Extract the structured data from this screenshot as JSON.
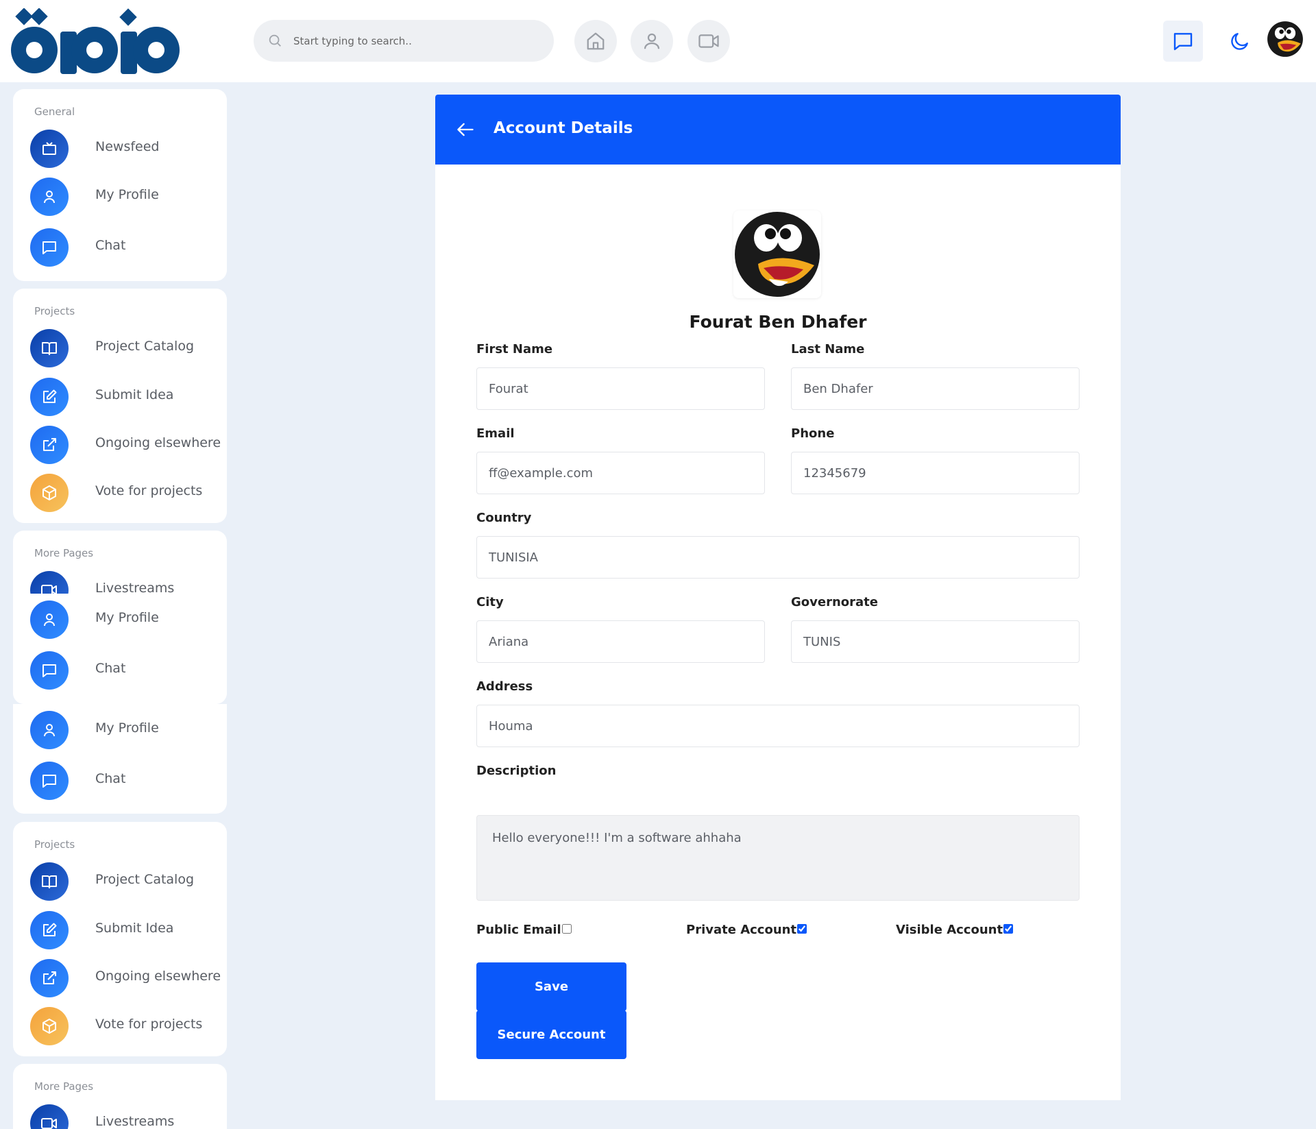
{
  "header": {
    "search_placeholder": "Start typing to search..",
    "icons": [
      "home-icon",
      "user-icon",
      "video-icon",
      "message-icon",
      "moon-icon"
    ]
  },
  "sidebar": {
    "cards": [
      {
        "title": "General",
        "items": [
          {
            "label": "Newsfeed",
            "icon": "tv-icon"
          },
          {
            "label": "My Profile",
            "icon": "user-icon"
          },
          {
            "label": "Chat",
            "icon": "message-icon"
          }
        ]
      },
      {
        "title": "Projects",
        "items": [
          {
            "label": "Project Catalog",
            "icon": "book-icon"
          },
          {
            "label": "Submit Idea",
            "icon": "edit-icon"
          },
          {
            "label": "Ongoing elsewhere",
            "icon": "external-link-icon"
          },
          {
            "label": "Vote for projects",
            "icon": "box-icon"
          }
        ]
      },
      {
        "title": "More Pages",
        "items": [
          {
            "label": "Livestreams",
            "icon": "video-icon"
          },
          {
            "label": "My Profile",
            "icon": "user-icon"
          },
          {
            "label": "Chat",
            "icon": "message-icon"
          }
        ]
      },
      {
        "title": "",
        "items": [
          {
            "label": "My Profile",
            "icon": "user-icon"
          },
          {
            "label": "Chat",
            "icon": "message-icon"
          }
        ]
      },
      {
        "title": "Projects",
        "items": [
          {
            "label": "Project Catalog",
            "icon": "book-icon"
          },
          {
            "label": "Submit Idea",
            "icon": "edit-icon"
          },
          {
            "label": "Ongoing elsewhere",
            "icon": "external-link-icon"
          },
          {
            "label": "Vote for projects",
            "icon": "box-icon"
          }
        ]
      },
      {
        "title": "More Pages",
        "items": [
          {
            "label": "Livestreams",
            "icon": "video-icon"
          }
        ]
      }
    ]
  },
  "account": {
    "title": "Account Details",
    "name": "Fourat Ben Dhafer",
    "fields": {
      "first_name": {
        "label": "First Name",
        "value": "Fourat"
      },
      "last_name": {
        "label": "Last Name",
        "value": "Ben Dhafer"
      },
      "email": {
        "label": "Email",
        "value": "ff@example.com"
      },
      "phone": {
        "label": "Phone",
        "value": "12345679"
      },
      "country": {
        "label": "Country",
        "value": "TUNISIA"
      },
      "city": {
        "label": "City",
        "value": "Ariana"
      },
      "governorate": {
        "label": "Governorate",
        "value": "TUNIS"
      },
      "address": {
        "label": "Address",
        "value": "Houma"
      },
      "description": {
        "label": "Description",
        "value": "Hello everyone!!! I'm a software ahhaha"
      }
    },
    "checkboxes": {
      "public_email": {
        "label": "Public Email",
        "checked": false
      },
      "private_account": {
        "label": "Private Account",
        "checked": true
      },
      "visible_account": {
        "label": "Visible Account",
        "checked": true
      }
    },
    "buttons": {
      "save": "Save",
      "secure": "Secure Account"
    }
  },
  "colors": {
    "primary": "#0a58fa",
    "page_bg": "#eaf0f8",
    "logo": "#0b4a86",
    "orange": "#f4a33c"
  }
}
